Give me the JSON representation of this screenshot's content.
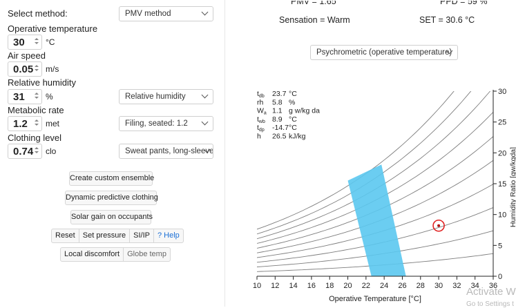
{
  "left": {
    "method_label": "Select method:",
    "method_value": "PMV method",
    "op_temp_label": "Operative temperature",
    "op_temp_value": "30",
    "op_temp_unit": "°C",
    "air_speed_label": "Air speed",
    "air_speed_value": "0.05",
    "air_speed_unit": "m/s",
    "rh_label": "Relative humidity",
    "rh_value": "31",
    "rh_unit": "%",
    "rh_select": "Relative humidity",
    "met_label": "Metabolic rate",
    "met_value": "1.2",
    "met_unit": "met",
    "met_select": "Filing, seated: 1.2",
    "clo_label": "Clothing level",
    "clo_value": "0.74",
    "clo_unit": "clo",
    "clo_select": "Sweat pants, long-sleeve",
    "btn_custom": "Create custom ensemble",
    "btn_dynamic": "Dynamic predictive clothing",
    "btn_solar": "Solar gain on occupants",
    "btn_reset": "Reset",
    "btn_pressure": "Set pressure",
    "btn_si": "SI/IP",
    "btn_help": "? Help",
    "btn_local": "Local discomfort",
    "btn_globe": "Globe temp"
  },
  "right": {
    "pmv_text": "PMV = 1.65",
    "ppd_text": "PPD = 59 %",
    "sensation_text": "Sensation = Warm",
    "set_text": "SET = 30.6 °C",
    "chart_select": "Psychrometric (operative temperature)"
  },
  "chart_data": {
    "type": "line",
    "xlabel": "Operative Temperature [°C]",
    "ylabel": "Humidity Ratio [gw/kgda]",
    "xlim": [
      10,
      36
    ],
    "ylim": [
      0,
      30
    ],
    "x_ticks": [
      "10",
      "12",
      "14",
      "16",
      "18",
      "20",
      "22",
      "24",
      "26",
      "28",
      "30",
      "32",
      "34",
      "36"
    ],
    "y_ticks": [
      "0",
      "5",
      "10",
      "15",
      "20",
      "25",
      "30"
    ],
    "rh_curves_percent": [
      10,
      20,
      30,
      40,
      50,
      60,
      70,
      80,
      90,
      100
    ],
    "comfort_zone": [
      [
        20.0,
        15.5
      ],
      [
        23.7,
        18.1
      ],
      [
        26.4,
        0
      ],
      [
        22.6,
        0
      ]
    ],
    "current_point": {
      "x": 30,
      "y": 8.2
    },
    "info": [
      {
        "sym": "t",
        "sub": "db",
        "val": "23.7",
        "unit": "°C"
      },
      {
        "sym": "rh",
        "sub": "",
        "val": "5.8",
        "unit": "%"
      },
      {
        "sym": "W",
        "sub": "a",
        "val": "1.1",
        "unit": "g w/kg da"
      },
      {
        "sym": "t",
        "sub": "wb",
        "val": "8.9",
        "unit": "°C"
      },
      {
        "sym": "t",
        "sub": "dp",
        "val": "-14.7",
        "unit": "°C"
      },
      {
        "sym": "h",
        "sub": "",
        "val": "26.5",
        "unit": "kJ/kg"
      }
    ],
    "zone_color": "#5bc8ef",
    "point_color": "#e02020"
  },
  "watermark": {
    "line1": "Activate Wi",
    "line2": "Go to Settings t"
  }
}
